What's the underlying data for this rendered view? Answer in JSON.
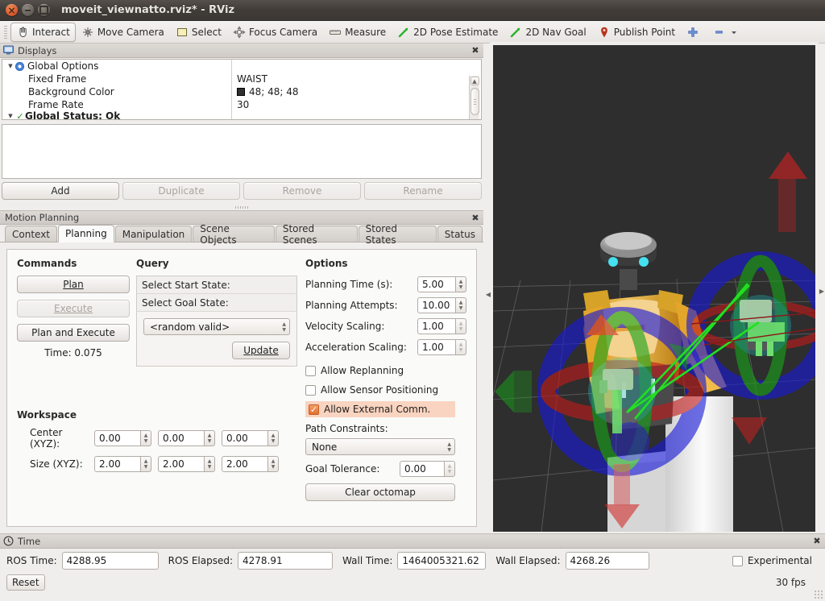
{
  "window": {
    "title": "moveit_viewnatto.rviz* - RViz",
    "controls": [
      "close",
      "minimize",
      "maximize"
    ]
  },
  "toolbar": {
    "items": [
      {
        "label": "Interact",
        "icon": "hand-cursor-icon",
        "active": true
      },
      {
        "label": "Move Camera",
        "icon": "move-camera-icon",
        "active": false
      },
      {
        "label": "Select",
        "icon": "select-box-icon",
        "active": false
      },
      {
        "label": "Focus Camera",
        "icon": "focus-camera-icon",
        "active": false
      },
      {
        "label": "Measure",
        "icon": "measure-icon",
        "active": false
      },
      {
        "label": "2D Pose Estimate",
        "icon": "pose-arrow-icon",
        "active": false
      },
      {
        "label": "2D Nav Goal",
        "icon": "nav-arrow-icon",
        "active": false
      },
      {
        "label": "Publish Point",
        "icon": "map-pin-icon",
        "active": false
      },
      {
        "label": "",
        "icon": "plus-icon",
        "active": false
      },
      {
        "label": "",
        "icon": "minus-dropdown-icon",
        "active": false
      }
    ]
  },
  "displays": {
    "title": "Displays",
    "close_label": "✖",
    "tree": [
      {
        "label": "Global Options",
        "value": "",
        "indent": 0,
        "icon": "gear-icon",
        "expander": "▼"
      },
      {
        "label": "Fixed Frame",
        "value": "WAIST",
        "indent": 1,
        "icon": "",
        "expander": ""
      },
      {
        "label": "Background Color",
        "value": "48; 48; 48",
        "indent": 1,
        "icon": "",
        "expander": "",
        "swatch": "#303030"
      },
      {
        "label": "Frame Rate",
        "value": "30",
        "indent": 1,
        "icon": "",
        "expander": ""
      },
      {
        "label": "Global Status: Ok",
        "value": "",
        "indent": 0,
        "icon": "check-icon",
        "expander": "▼"
      }
    ],
    "buttons": [
      {
        "label": "Add",
        "enabled": true
      },
      {
        "label": "Duplicate",
        "enabled": false
      },
      {
        "label": "Remove",
        "enabled": false
      },
      {
        "label": "Rename",
        "enabled": false
      }
    ]
  },
  "motion_planning": {
    "title": "Motion Planning",
    "close_label": "✖",
    "tabs": [
      {
        "label": "Context",
        "selected": false
      },
      {
        "label": "Planning",
        "selected": true
      },
      {
        "label": "Manipulation",
        "selected": false
      },
      {
        "label": "Scene Objects",
        "selected": false
      },
      {
        "label": "Stored Scenes",
        "selected": false
      },
      {
        "label": "Stored States",
        "selected": false
      },
      {
        "label": "Status",
        "selected": false
      }
    ],
    "commands": {
      "heading": "Commands",
      "plan_label": "Plan",
      "execute_label": "Execute",
      "plan_and_execute_label": "Plan and Execute",
      "time_label": "Time: 0.075"
    },
    "query": {
      "heading": "Query",
      "start_state_label": "Select Start State:",
      "goal_state_label": "Select Goal State:",
      "goal_state_value": "<random valid>",
      "update_label": "Update"
    },
    "options": {
      "heading": "Options",
      "fields": [
        {
          "label": "Planning Time (s):",
          "value": "5.00",
          "enabled": true
        },
        {
          "label": "Planning Attempts:",
          "value": "10.00",
          "enabled": true
        },
        {
          "label": "Velocity Scaling:",
          "value": "1.00",
          "enabled": false
        },
        {
          "label": "Acceleration Scaling:",
          "value": "1.00",
          "enabled": false
        }
      ],
      "checkboxes": [
        {
          "label": "Allow Replanning",
          "checked": false,
          "highlight": false
        },
        {
          "label": "Allow Sensor Positioning",
          "checked": false,
          "highlight": false
        },
        {
          "label": "Allow External Comm.",
          "checked": true,
          "highlight": true
        }
      ],
      "path_constraints_label": "Path Constraints:",
      "path_constraints_value": "None",
      "goal_tolerance_label": "Goal Tolerance:",
      "goal_tolerance_value": "0.00",
      "clear_octomap_label": "Clear octomap"
    },
    "workspace": {
      "heading": "Workspace",
      "center_label": "Center (XYZ):",
      "center_values": [
        "0.00",
        "0.00",
        "0.00"
      ],
      "size_label": "Size (XYZ):",
      "size_values": [
        "2.00",
        "2.00",
        "2.00"
      ]
    }
  },
  "time_panel": {
    "title": "Time",
    "close_label": "✖",
    "fields": [
      {
        "label": "ROS Time:",
        "value": "4288.95"
      },
      {
        "label": "ROS Elapsed:",
        "value": "4278.91"
      },
      {
        "label": "Wall Time:",
        "value": "1464005321.62"
      },
      {
        "label": "Wall Elapsed:",
        "value": "4268.26"
      }
    ],
    "experimental_label": "Experimental",
    "experimental_checked": false,
    "reset_label": "Reset",
    "fps_label": "30 fps"
  },
  "viewport": {
    "background_color": "#2e2e2e",
    "description": "3D view of humanoid robot with interactive marker rings and arrows"
  },
  "colors": {
    "accent_orange": "#e4702f",
    "highlight_bg": "#f9d4c0",
    "titlebar": "#413c38",
    "panel_bg": "#f0eeec",
    "viewport_bg": "#2e2e2e"
  }
}
